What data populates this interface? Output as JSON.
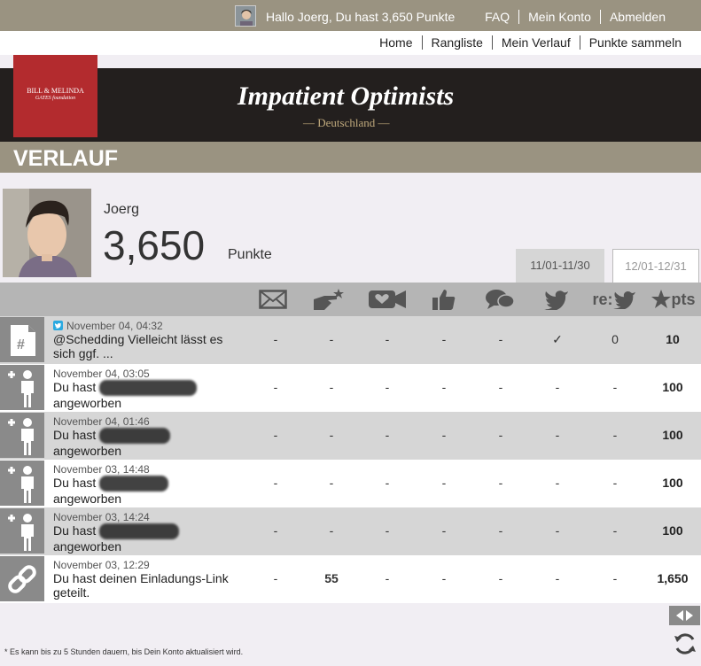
{
  "topbar": {
    "greeting": "Hallo Joerg, Du hast 3,650 Punkte",
    "links": [
      "FAQ",
      "Mein Konto",
      "Abmelden"
    ]
  },
  "nav": {
    "links": [
      "Home",
      "Rangliste",
      "Mein Verlauf",
      "Punkte sammeln"
    ]
  },
  "banner": {
    "logo_line1": "BILL & MELINDA",
    "logo_line2": "GATES foundation",
    "title": "Impatient Optimists",
    "subtitle": "— Deutschland —"
  },
  "page": {
    "heading": "VERLAUF"
  },
  "profile": {
    "name": "Joerg",
    "points": "3,650",
    "points_label": "Punkte"
  },
  "tabs": [
    {
      "label": "11/01-11/30",
      "active": true
    },
    {
      "label": "12/01-12/31",
      "active": false
    }
  ],
  "columns": [
    "mail-icon",
    "share-icon",
    "video-icon",
    "like-icon",
    "comment-icon",
    "twitter-icon",
    "retweet-icon",
    "pts-icon"
  ],
  "column_labels": {
    "retweet": "re:",
    "pts": "pts"
  },
  "rows": [
    {
      "icon": "hashtag-document-icon",
      "meta": "November 04, 04:32",
      "desc": "@Schedding Vielleicht lässt es sich ggf. ...",
      "cells": [
        "-",
        "-",
        "-",
        "-",
        "-",
        "✓",
        "0"
      ],
      "pts": "10"
    },
    {
      "icon": "add-user-icon",
      "meta": "November 04, 03:05",
      "desc_prefix": "Du hast",
      "desc_suffix": "angeworben",
      "cells": [
        "-",
        "-",
        "-",
        "-",
        "-",
        "-",
        "-"
      ],
      "pts": "100"
    },
    {
      "icon": "add-user-icon",
      "meta": "November 04, 01:46",
      "desc_prefix": "Du hast",
      "desc_suffix": "angeworben",
      "cells": [
        "-",
        "-",
        "-",
        "-",
        "-",
        "-",
        "-"
      ],
      "pts": "100"
    },
    {
      "icon": "add-user-icon",
      "meta": "November 03, 14:48",
      "desc_prefix": "Du hast",
      "desc_suffix": "angeworben",
      "cells": [
        "-",
        "-",
        "-",
        "-",
        "-",
        "-",
        "-"
      ],
      "pts": "100"
    },
    {
      "icon": "add-user-icon",
      "meta": "November 03, 14:24",
      "desc_prefix": "Du hast",
      "desc_suffix": "angeworben",
      "cells": [
        "-",
        "-",
        "-",
        "-",
        "-",
        "-",
        "-"
      ],
      "pts": "100"
    },
    {
      "icon": "link-icon",
      "meta": "November 03, 12:29",
      "desc": "Du hast deinen Einladungs-Link geteilt.",
      "cells": [
        "-",
        "55",
        "-",
        "-",
        "-",
        "-",
        "-"
      ],
      "pts": "1,650"
    }
  ],
  "footer": {
    "note": "* Es kann bis zu 5 Stunden dauern, bis Dein Konto aktualisiert wird."
  }
}
